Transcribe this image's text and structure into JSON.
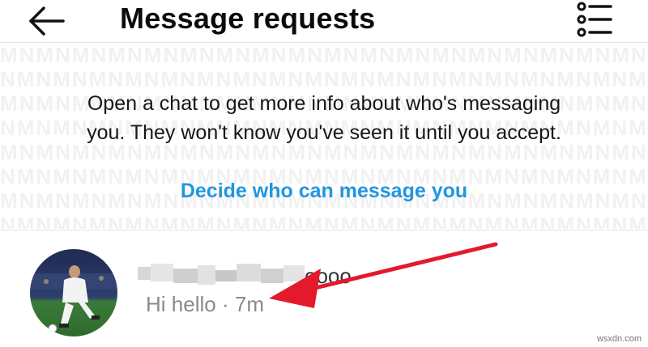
{
  "header": {
    "title": "Message requests",
    "back_icon": "arrow-left-icon",
    "filter_icon": "filter-list-icon"
  },
  "info": {
    "text": "Open a chat to get more info about who's messaging you. They won't know you've seen it until you accept.",
    "link_label": "Decide who can message you"
  },
  "requests": [
    {
      "name_visible_suffix": "oooo",
      "preview_text": "Hi hello",
      "separator": "·",
      "time": "7m"
    }
  ],
  "watermark": "wsxdn.com",
  "colors": {
    "link": "#2196e0",
    "annotation_arrow": "#e21a2c",
    "secondary_text": "#8a8a8a"
  }
}
